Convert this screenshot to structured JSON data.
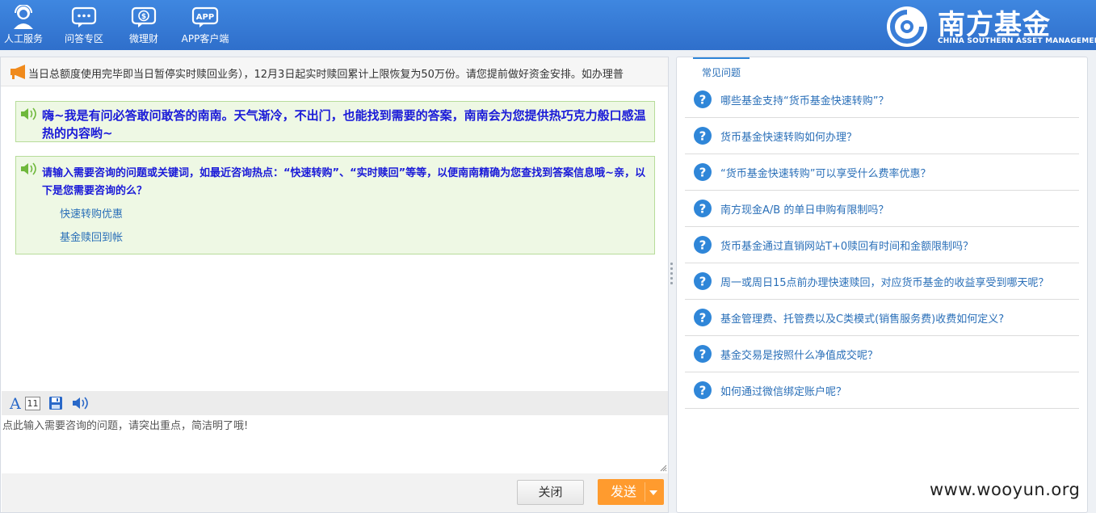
{
  "header": {
    "nav": [
      {
        "label": "人工服务",
        "icon": "customer-service-icon"
      },
      {
        "label": "问答专区",
        "icon": "chat-bubble-icon"
      },
      {
        "label": "微理财",
        "icon": "money-bubble-icon"
      },
      {
        "label": "APP客户端",
        "icon": "app-bubble-icon"
      }
    ],
    "app_icon_text": "APP",
    "logo": {
      "cn": "南方基金",
      "en": "CHINA SOUTHERN ASSET MANAGEMENT"
    }
  },
  "notice": {
    "text": "当日总额度使用完毕即当日暂停实时赎回业务），12月3日起实时赎回累计上限恢复为50万份。请您提前做好资金安排。如办理普"
  },
  "chat": {
    "greeting": "嗨~我是有问必答敢问敢答的南南。天气渐冷，不出门，也能找到需要的答案，南南会为您提供热巧克力般口感温热的内容哟~",
    "prompt": "请输入需要咨询的问题或关键词，如最近咨询热点：“快速转购”、“实时赎回”等等，以便南南精确为您查找到答案信息哦~亲，以下是您需要咨询的么？",
    "options": [
      "快速转购优惠",
      "基金赎回到帐"
    ]
  },
  "toolbar": {
    "font_size": "11"
  },
  "input": {
    "placeholder": "点此输入需要咨询的问题，请突出重点，简洁明了哦!",
    "value": ""
  },
  "buttons": {
    "close": "关闭",
    "send": "发送"
  },
  "faq": {
    "tab_label": "常见问题",
    "items": [
      "哪些基金支持“货币基金快速转购”？",
      "货币基金快速转购如何办理？",
      "“货币基金快速转购”可以享受什么费率优惠？",
      "南方现金A/B 的单日申购有限制吗？",
      "货币基金通过直销网站T+0赎回有时间和金额限制吗？",
      "周一或周日15点前办理快速赎回，对应货币基金的收益享受到哪天呢？",
      "基金管理费、托管费以及C类模式(销售服务费)收费如何定义?",
      "基金交易是按照什么净值成交呢？",
      "如何通过微信绑定账户呢？"
    ]
  },
  "watermark": "www.wooyun.org",
  "colors": {
    "header_blue": "#3a7ed8",
    "send_orange": "#ff9b2e",
    "link_blue": "#2a6fb8",
    "message_green": "#eef8e4"
  }
}
